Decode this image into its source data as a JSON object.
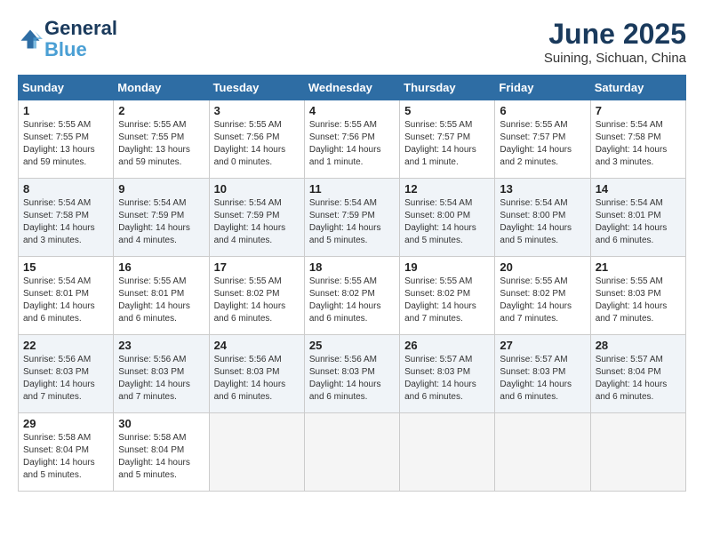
{
  "header": {
    "logo_line1": "General",
    "logo_line2": "Blue",
    "month_title": "June 2025",
    "location": "Suining, Sichuan, China"
  },
  "days_of_week": [
    "Sunday",
    "Monday",
    "Tuesday",
    "Wednesday",
    "Thursday",
    "Friday",
    "Saturday"
  ],
  "weeks": [
    [
      {
        "day": "1",
        "content": "Sunrise: 5:55 AM\nSunset: 7:55 PM\nDaylight: 13 hours\nand 59 minutes."
      },
      {
        "day": "2",
        "content": "Sunrise: 5:55 AM\nSunset: 7:55 PM\nDaylight: 13 hours\nand 59 minutes."
      },
      {
        "day": "3",
        "content": "Sunrise: 5:55 AM\nSunset: 7:56 PM\nDaylight: 14 hours\nand 0 minutes."
      },
      {
        "day": "4",
        "content": "Sunrise: 5:55 AM\nSunset: 7:56 PM\nDaylight: 14 hours\nand 1 minute."
      },
      {
        "day": "5",
        "content": "Sunrise: 5:55 AM\nSunset: 7:57 PM\nDaylight: 14 hours\nand 1 minute."
      },
      {
        "day": "6",
        "content": "Sunrise: 5:55 AM\nSunset: 7:57 PM\nDaylight: 14 hours\nand 2 minutes."
      },
      {
        "day": "7",
        "content": "Sunrise: 5:54 AM\nSunset: 7:58 PM\nDaylight: 14 hours\nand 3 minutes."
      }
    ],
    [
      {
        "day": "8",
        "content": "Sunrise: 5:54 AM\nSunset: 7:58 PM\nDaylight: 14 hours\nand 3 minutes."
      },
      {
        "day": "9",
        "content": "Sunrise: 5:54 AM\nSunset: 7:59 PM\nDaylight: 14 hours\nand 4 minutes."
      },
      {
        "day": "10",
        "content": "Sunrise: 5:54 AM\nSunset: 7:59 PM\nDaylight: 14 hours\nand 4 minutes."
      },
      {
        "day": "11",
        "content": "Sunrise: 5:54 AM\nSunset: 7:59 PM\nDaylight: 14 hours\nand 5 minutes."
      },
      {
        "day": "12",
        "content": "Sunrise: 5:54 AM\nSunset: 8:00 PM\nDaylight: 14 hours\nand 5 minutes."
      },
      {
        "day": "13",
        "content": "Sunrise: 5:54 AM\nSunset: 8:00 PM\nDaylight: 14 hours\nand 5 minutes."
      },
      {
        "day": "14",
        "content": "Sunrise: 5:54 AM\nSunset: 8:01 PM\nDaylight: 14 hours\nand 6 minutes."
      }
    ],
    [
      {
        "day": "15",
        "content": "Sunrise: 5:54 AM\nSunset: 8:01 PM\nDaylight: 14 hours\nand 6 minutes."
      },
      {
        "day": "16",
        "content": "Sunrise: 5:55 AM\nSunset: 8:01 PM\nDaylight: 14 hours\nand 6 minutes."
      },
      {
        "day": "17",
        "content": "Sunrise: 5:55 AM\nSunset: 8:02 PM\nDaylight: 14 hours\nand 6 minutes."
      },
      {
        "day": "18",
        "content": "Sunrise: 5:55 AM\nSunset: 8:02 PM\nDaylight: 14 hours\nand 6 minutes."
      },
      {
        "day": "19",
        "content": "Sunrise: 5:55 AM\nSunset: 8:02 PM\nDaylight: 14 hours\nand 7 minutes."
      },
      {
        "day": "20",
        "content": "Sunrise: 5:55 AM\nSunset: 8:02 PM\nDaylight: 14 hours\nand 7 minutes."
      },
      {
        "day": "21",
        "content": "Sunrise: 5:55 AM\nSunset: 8:03 PM\nDaylight: 14 hours\nand 7 minutes."
      }
    ],
    [
      {
        "day": "22",
        "content": "Sunrise: 5:56 AM\nSunset: 8:03 PM\nDaylight: 14 hours\nand 7 minutes."
      },
      {
        "day": "23",
        "content": "Sunrise: 5:56 AM\nSunset: 8:03 PM\nDaylight: 14 hours\nand 7 minutes."
      },
      {
        "day": "24",
        "content": "Sunrise: 5:56 AM\nSunset: 8:03 PM\nDaylight: 14 hours\nand 6 minutes."
      },
      {
        "day": "25",
        "content": "Sunrise: 5:56 AM\nSunset: 8:03 PM\nDaylight: 14 hours\nand 6 minutes."
      },
      {
        "day": "26",
        "content": "Sunrise: 5:57 AM\nSunset: 8:03 PM\nDaylight: 14 hours\nand 6 minutes."
      },
      {
        "day": "27",
        "content": "Sunrise: 5:57 AM\nSunset: 8:03 PM\nDaylight: 14 hours\nand 6 minutes."
      },
      {
        "day": "28",
        "content": "Sunrise: 5:57 AM\nSunset: 8:04 PM\nDaylight: 14 hours\nand 6 minutes."
      }
    ],
    [
      {
        "day": "29",
        "content": "Sunrise: 5:58 AM\nSunset: 8:04 PM\nDaylight: 14 hours\nand 5 minutes."
      },
      {
        "day": "30",
        "content": "Sunrise: 5:58 AM\nSunset: 8:04 PM\nDaylight: 14 hours\nand 5 minutes."
      },
      {
        "day": "",
        "content": ""
      },
      {
        "day": "",
        "content": ""
      },
      {
        "day": "",
        "content": ""
      },
      {
        "day": "",
        "content": ""
      },
      {
        "day": "",
        "content": ""
      }
    ]
  ]
}
